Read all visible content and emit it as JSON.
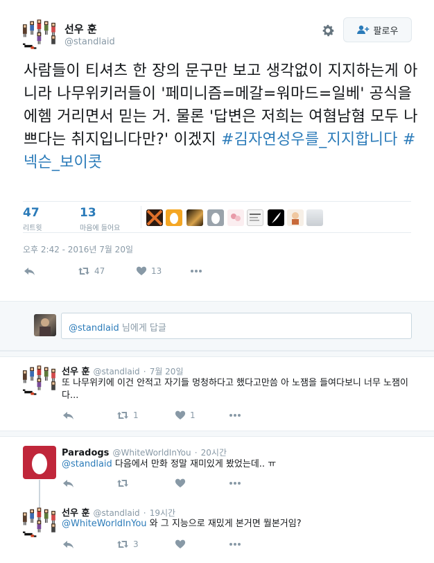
{
  "colors": {
    "accent": "#2b7bb9",
    "muted": "#8899a6",
    "border": "#e6ecf0",
    "egg": "#c0263a"
  },
  "main": {
    "author_name": "선우 훈",
    "handle": "@standlaid",
    "follow_label": "팔로우",
    "text_plain": "사람들이 티셔츠 한 장의 문구만 보고 생각없이 지지하는게 아니라 나무위키러들이 '페미니즘=메갈=워마드=일베' 공식을 에헴 거리면서 믿는 거. 물론 '답변은 저희는 여혐남혐 모두 나쁘다는 취지입니다만?' 이겠지",
    "hashtag1": "#김자연성우를_지지합니다",
    "hashtag2": "#넥슨_보이콧",
    "retweets": "47",
    "retweets_label": "리트윗",
    "likes": "13",
    "likes_label": "마음에 들어요",
    "timestamp": "오후 2:42 - 2016년 7월 20일",
    "action_retweets": "47",
    "action_likes": "13"
  },
  "reply_box": {
    "mention": "@standlaid",
    "placeholder_rest": " 님에게 답글"
  },
  "replies": [
    {
      "name": "선우 훈",
      "handle": "@standlaid",
      "time": "7월 20일",
      "text": "또 나무위키에 이건 안적고 자기들 멍청하다고 했다고만씀 아 노잼을 들여다보니 너무 노잼이다...",
      "retweets": "1",
      "likes": "1"
    },
    {
      "name": "Paradogs",
      "handle": "@WhiteWorldInYou",
      "time": "20시간",
      "mention": "@standlaid",
      "text": " 다음에서 만화 정말 재미있게 봤었는데.. ㅠ"
    },
    {
      "name": "선우 훈",
      "handle": "@standlaid",
      "time": "19시간",
      "mention": "@WhiteWorldInYou",
      "text": " 와 그 지능으로 재밌게 본거면 뭘본거임?",
      "retweets": "3"
    }
  ],
  "icons": [
    "pixel-avatar-icon",
    "gear-icon",
    "follow-person-icon",
    "reply-icon",
    "retweet-icon",
    "heart-icon",
    "more-icon"
  ]
}
